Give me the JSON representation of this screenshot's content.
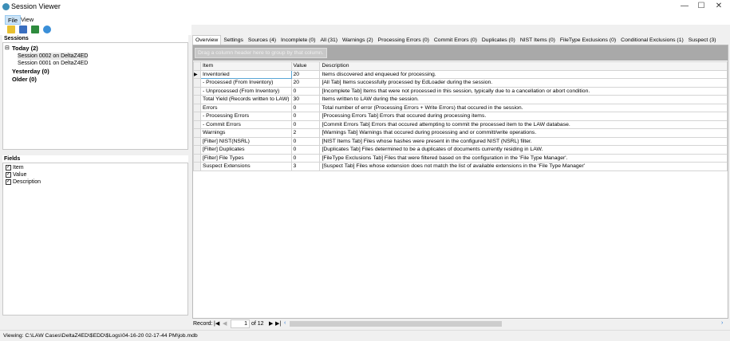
{
  "window": {
    "title": "Session Viewer",
    "controls": [
      "—",
      "☐",
      "✕"
    ]
  },
  "menu": [
    "File",
    "View"
  ],
  "toolbar": [
    {
      "name": "open",
      "color": "#e8c030"
    },
    {
      "name": "save",
      "color": "#3a6fc0"
    },
    {
      "name": "export-excel",
      "color": "#2e8b3e"
    },
    {
      "name": "refresh",
      "color": "#3a8fd8"
    }
  ],
  "sessions": {
    "header": "Sessions",
    "groups": [
      {
        "label": "Today (2)",
        "children": [
          "Session 0002 on DeltaZ4ED",
          "Session 0001 on DeltaZ4ED"
        ]
      },
      {
        "label": "Yesterday (0)"
      },
      {
        "label": "Older (0)"
      }
    ]
  },
  "fields": {
    "header": "Fields",
    "items": [
      "Item",
      "Value",
      "Description"
    ]
  },
  "tabs": [
    "Overview",
    "Settings",
    "Sources (4)",
    "Incomplete (0)",
    "All (31)",
    "Warnings (2)",
    "Processing Errors (0)",
    "Commit Errors (0)",
    "Duplicates (0)",
    "NIST Items (0)",
    "FileType Exclusions (0)",
    "Conditional Exclusions (1)",
    "Suspect (3)"
  ],
  "grid": {
    "group_hint": "Drag a column header here to group by that column.",
    "columns": [
      "Item",
      "Value",
      "Description"
    ],
    "rows": [
      [
        "Inventoried",
        "20",
        "Items discovered and enqueued for processing."
      ],
      [
        " - Processed (From Inventory)",
        "20",
        "[All Tab] Items successfully processed by EdLoader during the session."
      ],
      [
        " - Unprocessed (From Inventory)",
        "0",
        "[Incomplete Tab] Items that were not processed in this session, typically due to a cancellation or abort condition."
      ],
      [
        "Total Yield (Records written to LAW)",
        "30",
        "Items written to LAW during the session."
      ],
      [
        "Errors",
        "0",
        "Total number of error (Processing Errors + Write Errors) that occured in the session."
      ],
      [
        " - Processing Errors",
        "0",
        "[Processing Errors Tab] Errors that occured during processing items."
      ],
      [
        " - Commit Errors",
        "0",
        "[Commit Errors Tab] Errors that occured attempting to commit the processed item to the LAW database."
      ],
      [
        "Warnings",
        "2",
        "[Warnings Tab] Warnings that occured during processing and or committ/write operations."
      ],
      [
        "[Filter] NIST(NSRL)",
        "0",
        "[NIST Items Tab] Files whose hashes were present in the configured NIST (NSRL) filter."
      ],
      [
        "[Filter] Duplicates",
        "0",
        "[Duplicates Tab] Files determined to be a duplicates of documents currently residing in LAW."
      ],
      [
        "[Filter] File Types",
        "0",
        "[FileType Exclusions Tab] Files that were filtered based on the configuration in the 'File Type Manager'."
      ],
      [
        "Suspect Extensions",
        "3",
        "[Suspect Tab] Files whose extension does not match the list of available extensions in the 'File Type Manager'"
      ]
    ]
  },
  "nav": {
    "label": "Record:",
    "current": "1",
    "of": "of 12"
  },
  "status": "Viewing: C:\\LAW Cases\\DeltaZ4ED\\$EDD\\$Logs\\04-16-20 02-17-44 PM\\job.mdb"
}
